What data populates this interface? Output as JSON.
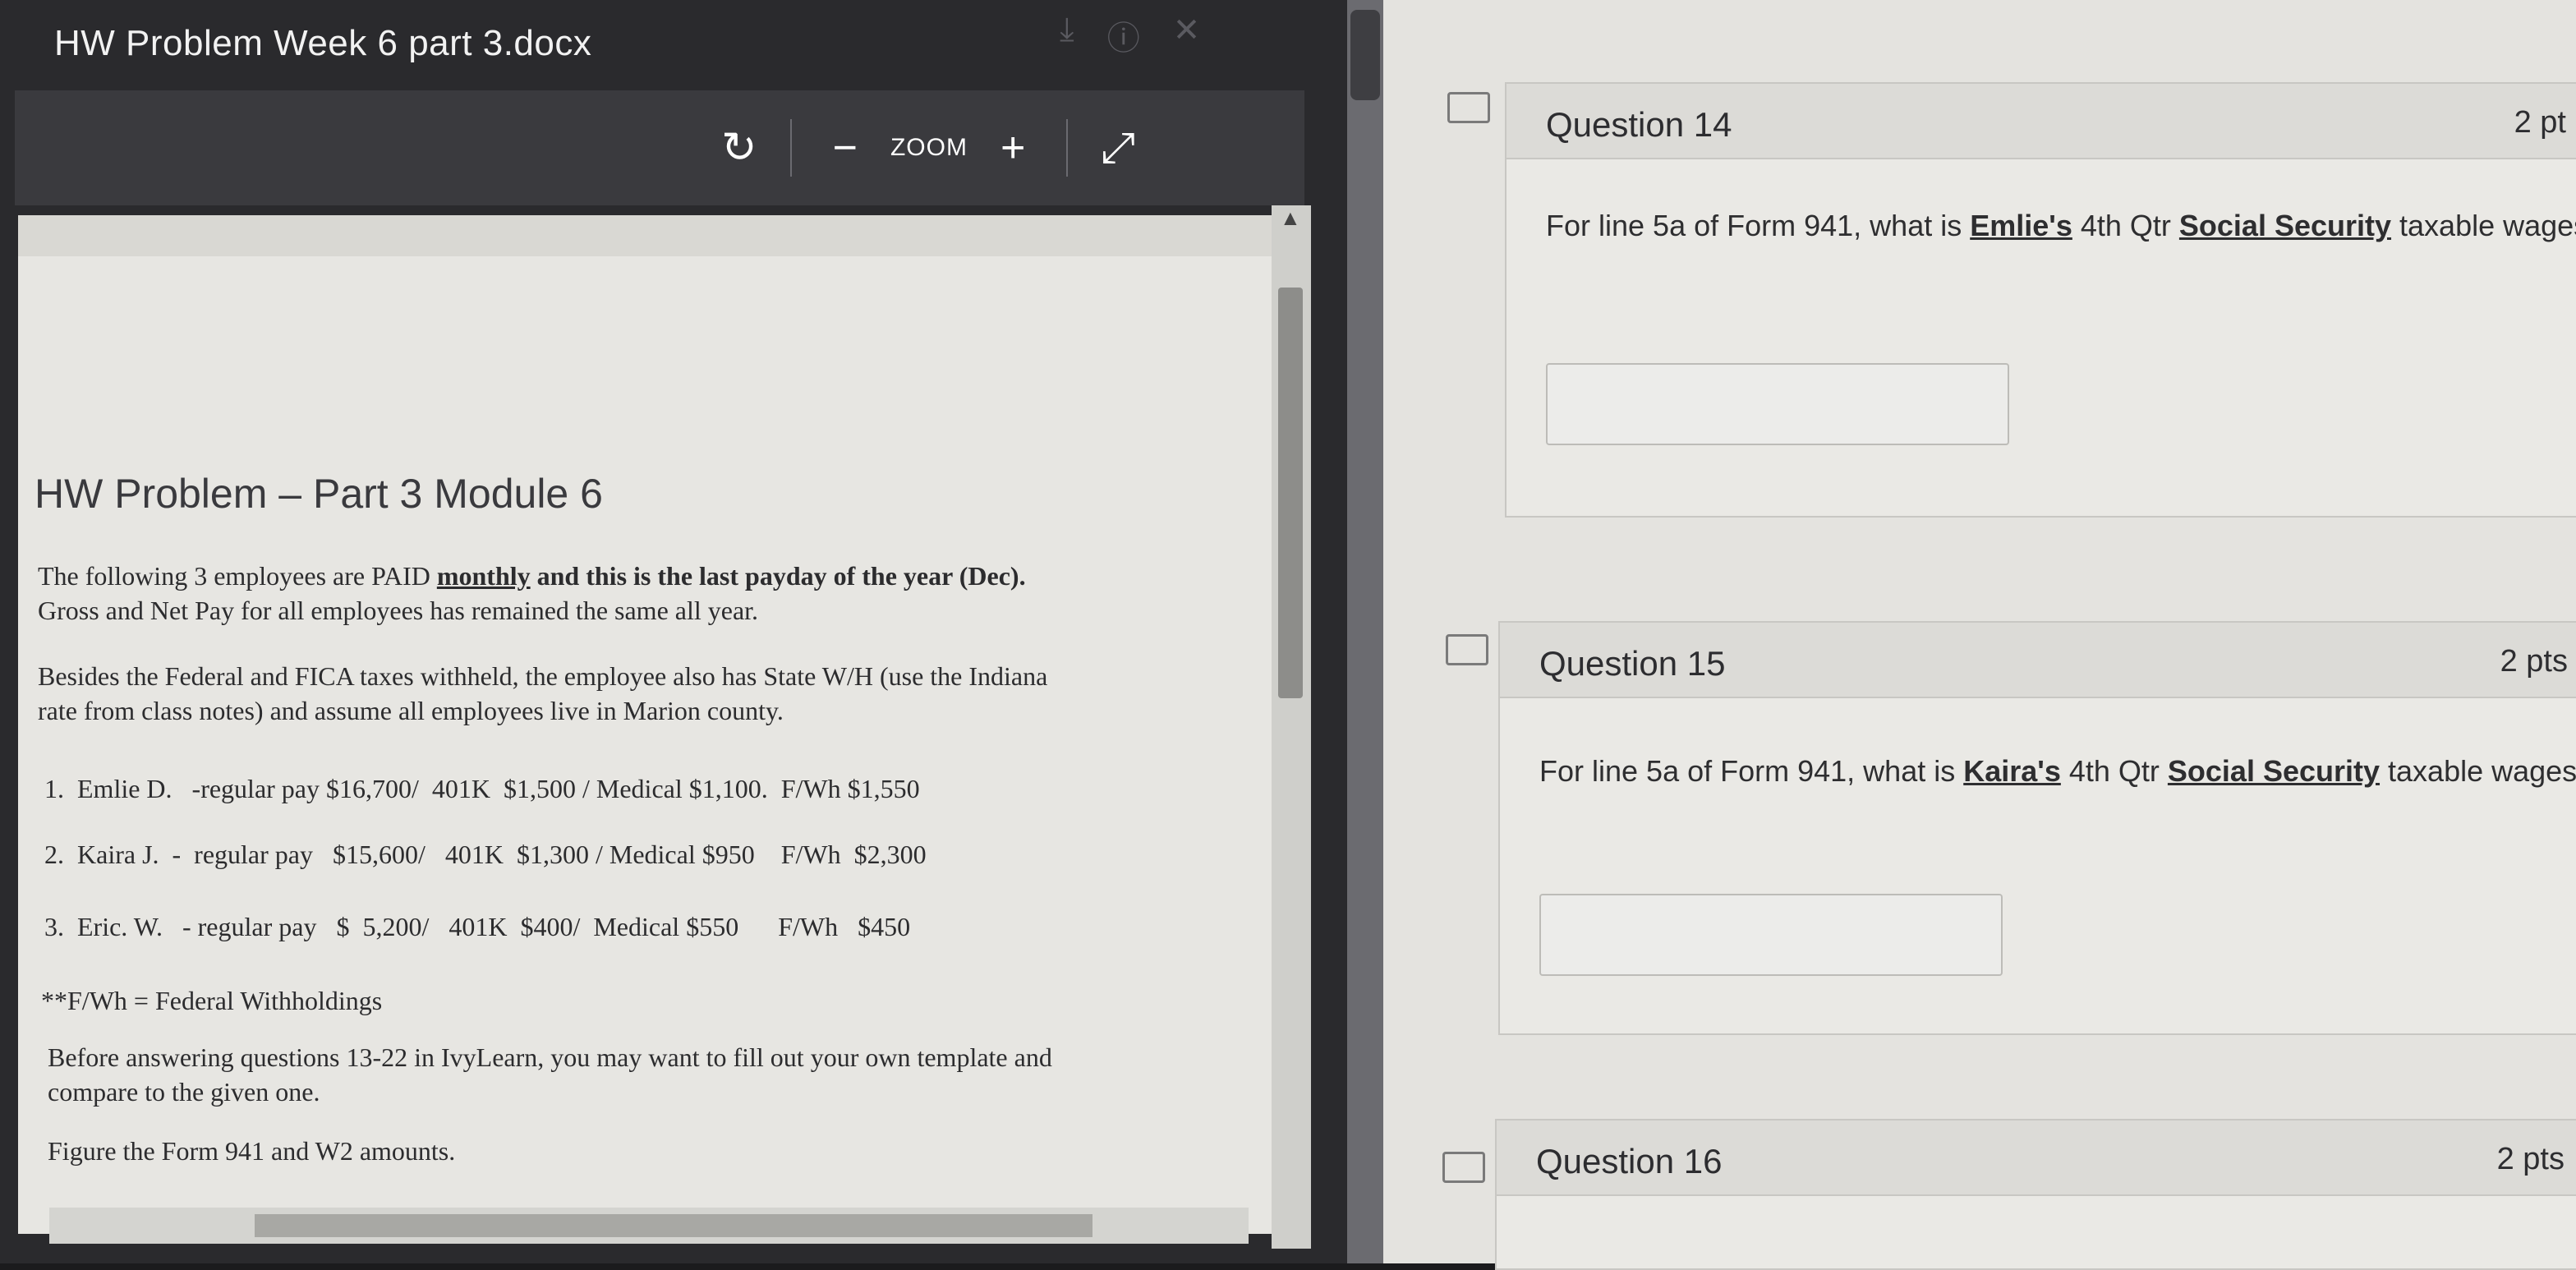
{
  "viewer": {
    "title": "HW Problem Week 6 part 3.docx",
    "toolbar": {
      "zoom_label": "ZOOM",
      "minus": "−",
      "plus": "+"
    }
  },
  "document": {
    "heading": "HW Problem – Part 3  Module 6",
    "p1_a": "The following 3 employees are PAID ",
    "p1_monthly": "monthly",
    "p1_b": " and this is the last payday of the year (Dec).",
    "p1_line2": "Gross and Net Pay for all employees has remained the same all year.",
    "p2_line1": "Besides the Federal and FICA taxes withheld, the employee also has State W/H (use the Indiana",
    "p2_line2": "rate from class notes) and assume all employees live in Marion county.",
    "list": [
      "1.  Emlie D.   -regular pay $16,700/  401K  $1,500 / Medical $1,100.  F/Wh $1,550",
      "2.  Kaira J.  -  regular pay   $15,600/   401K  $1,300 / Medical $950    F/Wh  $2,300",
      "3.  Eric. W.   - regular pay   $  5,200/   401K  $400/  Medical $550      F/Wh   $450"
    ],
    "note": "**F/Wh = Federal Withholdings",
    "p3_line1": "Before answering questions 13-22 in IvyLearn, you may want to fill out your own template and",
    "p3_line2": "compare to the given one.",
    "p4": "Figure the Form 941 and W2 amounts."
  },
  "questions": [
    {
      "title": "Question 14",
      "pts": "2 pt",
      "text_a": "For line 5a of Form 941, what is ",
      "name": "Emlie's",
      "text_b": " 4th Qtr ",
      "ss": "Social Security",
      "text_c": " taxable wages?"
    },
    {
      "title": "Question 15",
      "pts": "2 pts",
      "text_a": "For line 5a of Form 941, what is ",
      "name": "Kaira's",
      "text_b": " 4th Qtr ",
      "ss": "Social Security",
      "text_c": " taxable wages?"
    },
    {
      "title": "Question 16",
      "pts": "2 pts"
    }
  ]
}
